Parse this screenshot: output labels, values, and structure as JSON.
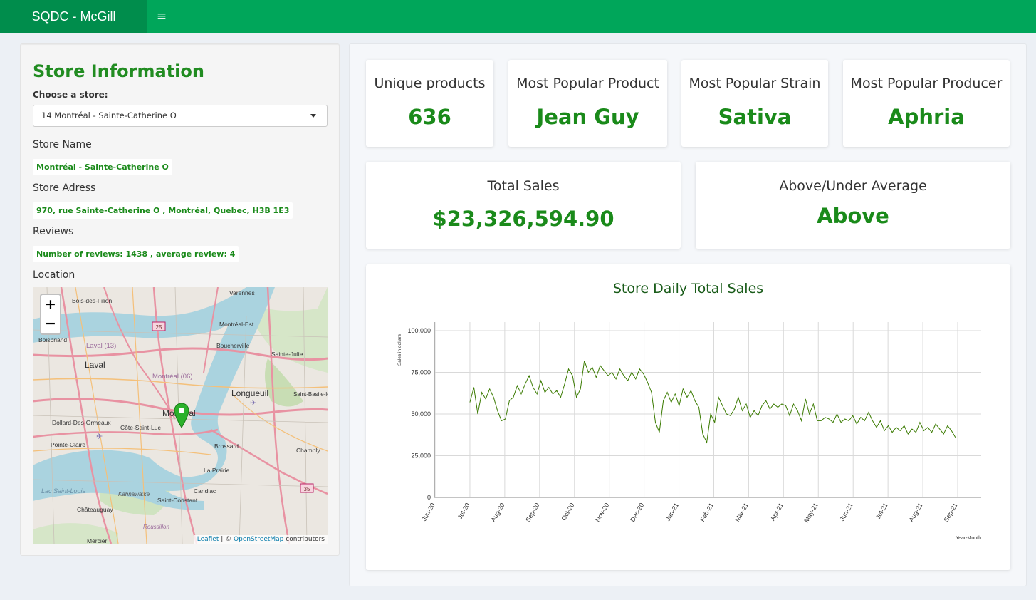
{
  "app": {
    "title": "SQDC - McGill",
    "menu_icon": "hamburger-icon"
  },
  "sidebar": {
    "title": "Store Information",
    "choose_label": "Choose a store:",
    "store_select_value": "14 Montréal - Sainte-Catherine O",
    "store_name_label": "Store Name",
    "store_name_value": "Montréal - Sainte-Catherine O",
    "store_address_label": "Store Adress",
    "store_address_value": "970, rue Sainte-Catherine O , Montréal, Quebec, H3B 1E3",
    "reviews_label": "Reviews",
    "reviews_value": "Number of reviews: 1438 , average review: 4",
    "location_label": "Location"
  },
  "map": {
    "zoom_in": "+",
    "zoom_out": "−",
    "attribution_leaflet": "Leaflet",
    "attribution_sep": " | © ",
    "attribution_osm": "OpenStreetMap",
    "attribution_tail": " contributors",
    "places": [
      {
        "name": "Varennes"
      },
      {
        "name": "Bois-des-Filion"
      },
      {
        "name": "Montréal-Est"
      },
      {
        "name": "Boucherville"
      },
      {
        "name": "Sainte-Julie"
      },
      {
        "name": "Laval (13)"
      },
      {
        "name": "Laval"
      },
      {
        "name": "Boisbriand"
      },
      {
        "name": "Montréal (06)"
      },
      {
        "name": "Longueuil"
      },
      {
        "name": "Saint-Basile-le-Grand"
      },
      {
        "name": "Montréal"
      },
      {
        "name": "Dollard-Des-Ormeaux"
      },
      {
        "name": "Côte-Saint-Luc"
      },
      {
        "name": "Pointe-Claire"
      },
      {
        "name": "Brossard"
      },
      {
        "name": "Chambly"
      },
      {
        "name": "La Prairie"
      },
      {
        "name": "Kahnawà:ke"
      },
      {
        "name": "Candiac"
      },
      {
        "name": "Châteauguay"
      },
      {
        "name": "Saint-Constant"
      },
      {
        "name": "Lac Saint-Louis"
      },
      {
        "name": "Roussillon"
      },
      {
        "name": "Mercier"
      },
      {
        "name": "25"
      },
      {
        "name": "35"
      }
    ]
  },
  "kpis": {
    "unique_products": {
      "label": "Unique products",
      "value": "636"
    },
    "popular_product": {
      "label": "Most Popular Product",
      "value": "Jean Guy"
    },
    "popular_strain": {
      "label": "Most Popular Strain",
      "value": "Sativa"
    },
    "popular_producer": {
      "label": "Most Popular Producer",
      "value": "Aphria"
    },
    "total_sales": {
      "label": "Total Sales",
      "value": "$23,326,594.90"
    },
    "above_under": {
      "label": "Above/Under Average",
      "value": "Above"
    }
  },
  "chart_data": {
    "type": "line",
    "title": "Store Daily Total Sales",
    "xlabel": "Year-Month",
    "ylabel": "Sales in dollars",
    "ylim": [
      0,
      100000
    ],
    "yticks": [
      0,
      25000,
      50000,
      75000,
      100000
    ],
    "ytick_labels": [
      "0",
      "25,000",
      "50,000",
      "75,000",
      "100,000"
    ],
    "xtick_labels": [
      "Jun-20",
      "Jul-20",
      "Aug-20",
      "Sep-20",
      "Oct-20",
      "Nov-20",
      "Dec-20",
      "Jan-21",
      "Feb-21",
      "Mar-21",
      "Apr-21",
      "May-21",
      "Jun-21",
      "Jul-21",
      "Aug-21",
      "Sep-21"
    ],
    "grid": true,
    "color": "#3a7a00",
    "series": [
      {
        "x_start": "2020-07-01",
        "x_end": "2021-08-30",
        "values": [
          57000,
          66000,
          50000,
          63000,
          59000,
          65000,
          60000,
          52000,
          46000,
          47000,
          58000,
          60000,
          67000,
          62000,
          68000,
          73000,
          66000,
          62000,
          70000,
          63000,
          66000,
          62000,
          64000,
          60000,
          68000,
          77000,
          73000,
          60000,
          65000,
          82000,
          75000,
          78000,
          72000,
          79000,
          76000,
          73000,
          75000,
          71000,
          77000,
          73000,
          70000,
          75000,
          71000,
          77000,
          74000,
          69000,
          63000,
          45000,
          39000,
          58000,
          63000,
          57000,
          62000,
          55000,
          65000,
          60000,
          64000,
          58000,
          54000,
          38000,
          33000,
          50000,
          45000,
          60000,
          55000,
          50000,
          49000,
          53000,
          60000,
          52000,
          56000,
          48000,
          52000,
          49000,
          55000,
          58000,
          53000,
          56000,
          54000,
          56000,
          55000,
          49000,
          56000,
          52000,
          46000,
          59000,
          50000,
          56000,
          46000,
          46000,
          48000,
          47000,
          45000,
          50000,
          45000,
          47000,
          46000,
          49000,
          44000,
          48000,
          46000,
          51000,
          46000,
          42000,
          46000,
          40000,
          43000,
          39000,
          42000,
          40000,
          43000,
          38000,
          41000,
          39000,
          45000,
          40000,
          42000,
          39000,
          44000,
          41000,
          38000,
          43000,
          40000,
          36000
        ]
      }
    ]
  }
}
